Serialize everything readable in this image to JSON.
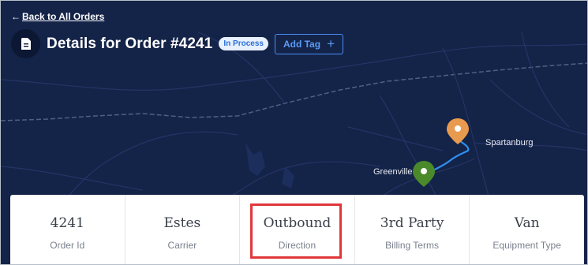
{
  "nav": {
    "back_label": "Back to All Orders",
    "back_icon": "arrow-left-icon"
  },
  "header": {
    "title": "Details for Order #4241",
    "status": "In Process",
    "add_tag_label": "Add Tag",
    "add_tag_icon": "plus-icon",
    "doc_icon": "document-icon"
  },
  "map": {
    "cities": [
      "Spartanburg",
      "Greenville"
    ],
    "origin_pin_color": "#4a8a2a",
    "destination_pin_color": "#e89a4e",
    "route_color": "#2f8ff0"
  },
  "summary": {
    "items": [
      {
        "value": "4241",
        "label": "Order Id"
      },
      {
        "value": "Estes",
        "label": "Carrier"
      },
      {
        "value": "Outbound",
        "label": "Direction"
      },
      {
        "value": "3rd Party",
        "label": "Billing Terms"
      },
      {
        "value": "Van",
        "label": "Equipment Type"
      }
    ],
    "highlighted_index": 2
  },
  "colors": {
    "map_bg": "#142348",
    "accent": "#4a8ef2",
    "highlight": "#e0373b"
  }
}
